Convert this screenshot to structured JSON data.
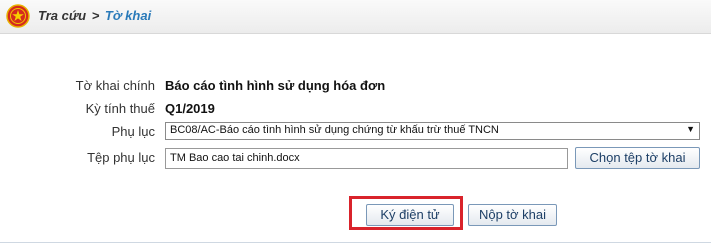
{
  "header": {
    "breadcrumb_root": "Tra cứu",
    "breadcrumb_sep": ">",
    "breadcrumb_current": "Tờ khai"
  },
  "form": {
    "to_khai_chinh_label": "Tờ khai chính",
    "to_khai_chinh_value": "Báo cáo tình hình sử dụng hóa đơn",
    "ky_tinh_thue_label": "Kỳ tính thuế",
    "ky_tinh_thue_value": "Q1/2019",
    "phu_luc_label": "Phụ lục",
    "phu_luc_selected": "BC08/AC-Báo cáo tình hình sử dụng chứng từ khấu trừ thuế TNCN",
    "tep_phu_luc_label": "Tệp phụ lục",
    "tep_phu_luc_value": "TM Bao cao tai chinh.docx",
    "choose_file_label": "Chọn tệp tờ khai"
  },
  "actions": {
    "sign_label": "Ký điện tử",
    "submit_label": "Nộp tờ khai"
  },
  "colors": {
    "accent": "#2a7ab9",
    "highlight": "#d9232b"
  },
  "icons": {
    "emblem": "national-emblem-icon",
    "dropdown": "chevron-down-icon"
  }
}
